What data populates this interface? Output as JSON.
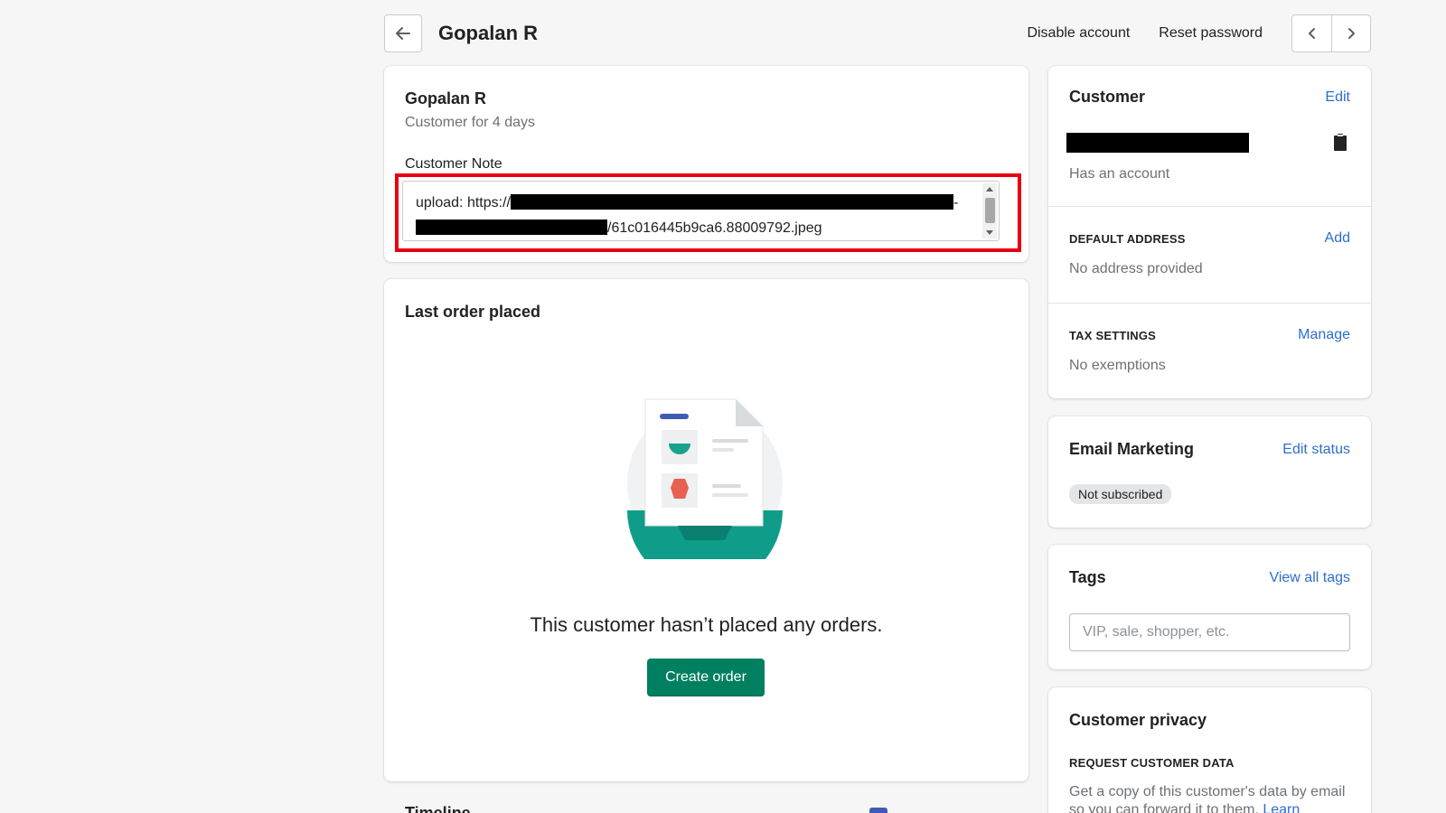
{
  "header": {
    "title": "Gopalan R",
    "actions": [
      "Disable account",
      "Reset password"
    ]
  },
  "main_card": {
    "name": "Gopalan R",
    "customer_since": "Customer for 4 days",
    "note_label": "Customer Note",
    "note_line1_prefix": "upload: https://",
    "note_line1_suffix": "-",
    "note_line2_suffix": "/61c016445b9ca6.88009792.jpeg"
  },
  "orders_card": {
    "title": "Last order placed",
    "empty_message": "This customer hasn’t placed any orders.",
    "create_button": "Create order"
  },
  "customer_card": {
    "title": "Customer",
    "edit_link": "Edit",
    "account_status": "Has an account",
    "default_address_title": "DEFAULT ADDRESS",
    "default_address_action": "Add",
    "default_address_value": "No address provided",
    "tax_title": "TAX SETTINGS",
    "tax_action": "Manage",
    "tax_value": "No exemptions"
  },
  "email_card": {
    "title": "Email Marketing",
    "action": "Edit status",
    "status_badge": "Not subscribed"
  },
  "tags_card": {
    "title": "Tags",
    "action": "View all tags",
    "placeholder": "VIP, sale, shopper, etc."
  },
  "privacy_card": {
    "title": "Customer privacy",
    "request_title": "REQUEST CUSTOMER DATA",
    "request_text": "Get a copy of this customer's data by email so you can forward it to them.",
    "learn_link": "Learn"
  },
  "timeline_peek": "Timeline",
  "colors": {
    "accent_green": "#008060",
    "link_blue": "#2c6ecb",
    "highlight_red": "#e60012"
  }
}
